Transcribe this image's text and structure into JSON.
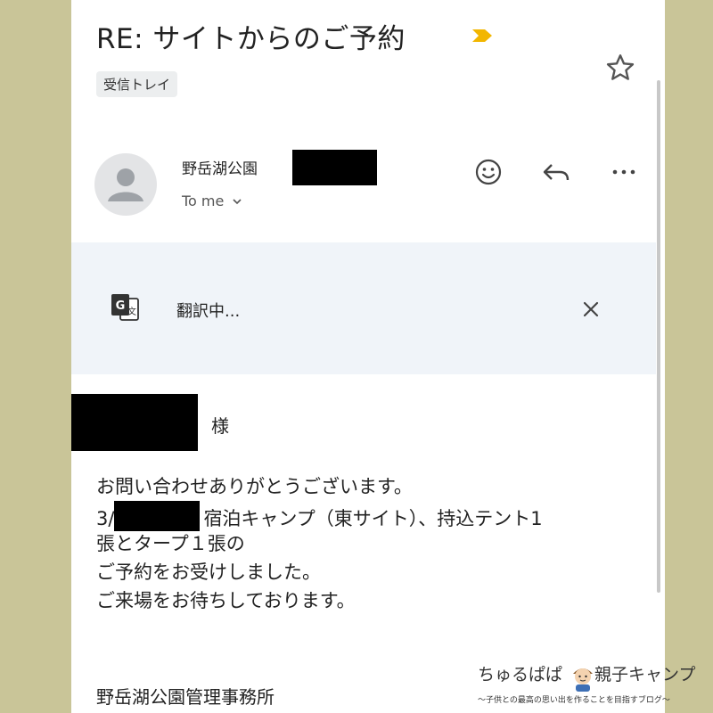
{
  "email": {
    "subject": "RE: サイトからのご予約",
    "label_chip": "受信トレイ",
    "sender_name": "野岳湖公園",
    "recipient_line": "To me",
    "icons": {
      "importance": "importance-marker-icon",
      "star": "star-icon",
      "avatar": "person-avatar-icon",
      "emoji": "emoji-react-icon",
      "reply": "reply-icon",
      "more": "more-options-icon",
      "expand": "chevron-down-icon",
      "translate": "translate-icon",
      "close": "close-icon"
    },
    "colors": {
      "importance": "#f2b600"
    }
  },
  "translate_bar": {
    "status_text": "翻訳中..."
  },
  "message": {
    "honorific": "様",
    "line1": "お問い合わせありがとうございます。",
    "line2_prefix": "3/",
    "line2_suffix": "宿泊キャンプ（東サイト）、持込テント1",
    "line3": "張とタープ１張の",
    "line4": "ご予約をお受けしました。",
    "line5": "ご来場をお待ちしております。",
    "signature": "野岳湖公園管理事務所"
  },
  "watermark": {
    "title_left": "ちゅるぱぱ",
    "title_right": "親子キャンプ",
    "subtitle": "～子供との最高の思い出を作ることを目指すブログ～"
  }
}
